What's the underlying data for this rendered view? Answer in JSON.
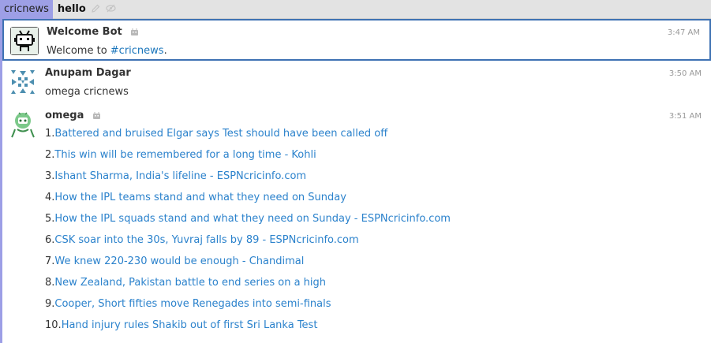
{
  "header": {
    "stream": "cricnews",
    "topic": "hello",
    "edit_icon": "pencil-icon",
    "mute_icon": "eye-slash-icon"
  },
  "colors": {
    "stream": "#9d9fe6",
    "link": "#2b82cc",
    "selection": "#3f72b3"
  },
  "messages": [
    {
      "sender": "Welcome Bot",
      "is_bot": true,
      "time": "3:47 AM",
      "text_prefix": "Welcome to ",
      "stream_link": "#cricnews",
      "text_suffix": "."
    },
    {
      "sender": "Anupam Dagar",
      "is_bot": false,
      "time": "3:50 AM",
      "text": "omega cricnews"
    },
    {
      "sender": "omega",
      "is_bot": true,
      "time": "3:51 AM",
      "items": [
        {
          "num": "1.",
          "title": "Battered and bruised Elgar says Test should have been called off"
        },
        {
          "num": "2.",
          "title": "This win will be remembered for a long time - Kohli"
        },
        {
          "num": "3.",
          "title": "Ishant Sharma, India's lifeline - ESPNcricinfo.com"
        },
        {
          "num": "4.",
          "title": "How the IPL teams stand and what they need on Sunday"
        },
        {
          "num": "5.",
          "title": "How the IPL squads stand and what they need on Sunday - ESPNcricinfo.com"
        },
        {
          "num": "6.",
          "title": "CSK soar into the 30s, Yuvraj falls by 89 - ESPNcricinfo.com"
        },
        {
          "num": "7.",
          "title": "We knew 220-230 would be enough - Chandimal"
        },
        {
          "num": "8.",
          "title": "New Zealand, Pakistan battle to end series on a high"
        },
        {
          "num": "9.",
          "title": "Cooper, Short fifties move Renegades into semi-finals"
        },
        {
          "num": "10.",
          "title": "Hand injury rules Shakib out of first Sri Lanka Test"
        }
      ]
    }
  ]
}
